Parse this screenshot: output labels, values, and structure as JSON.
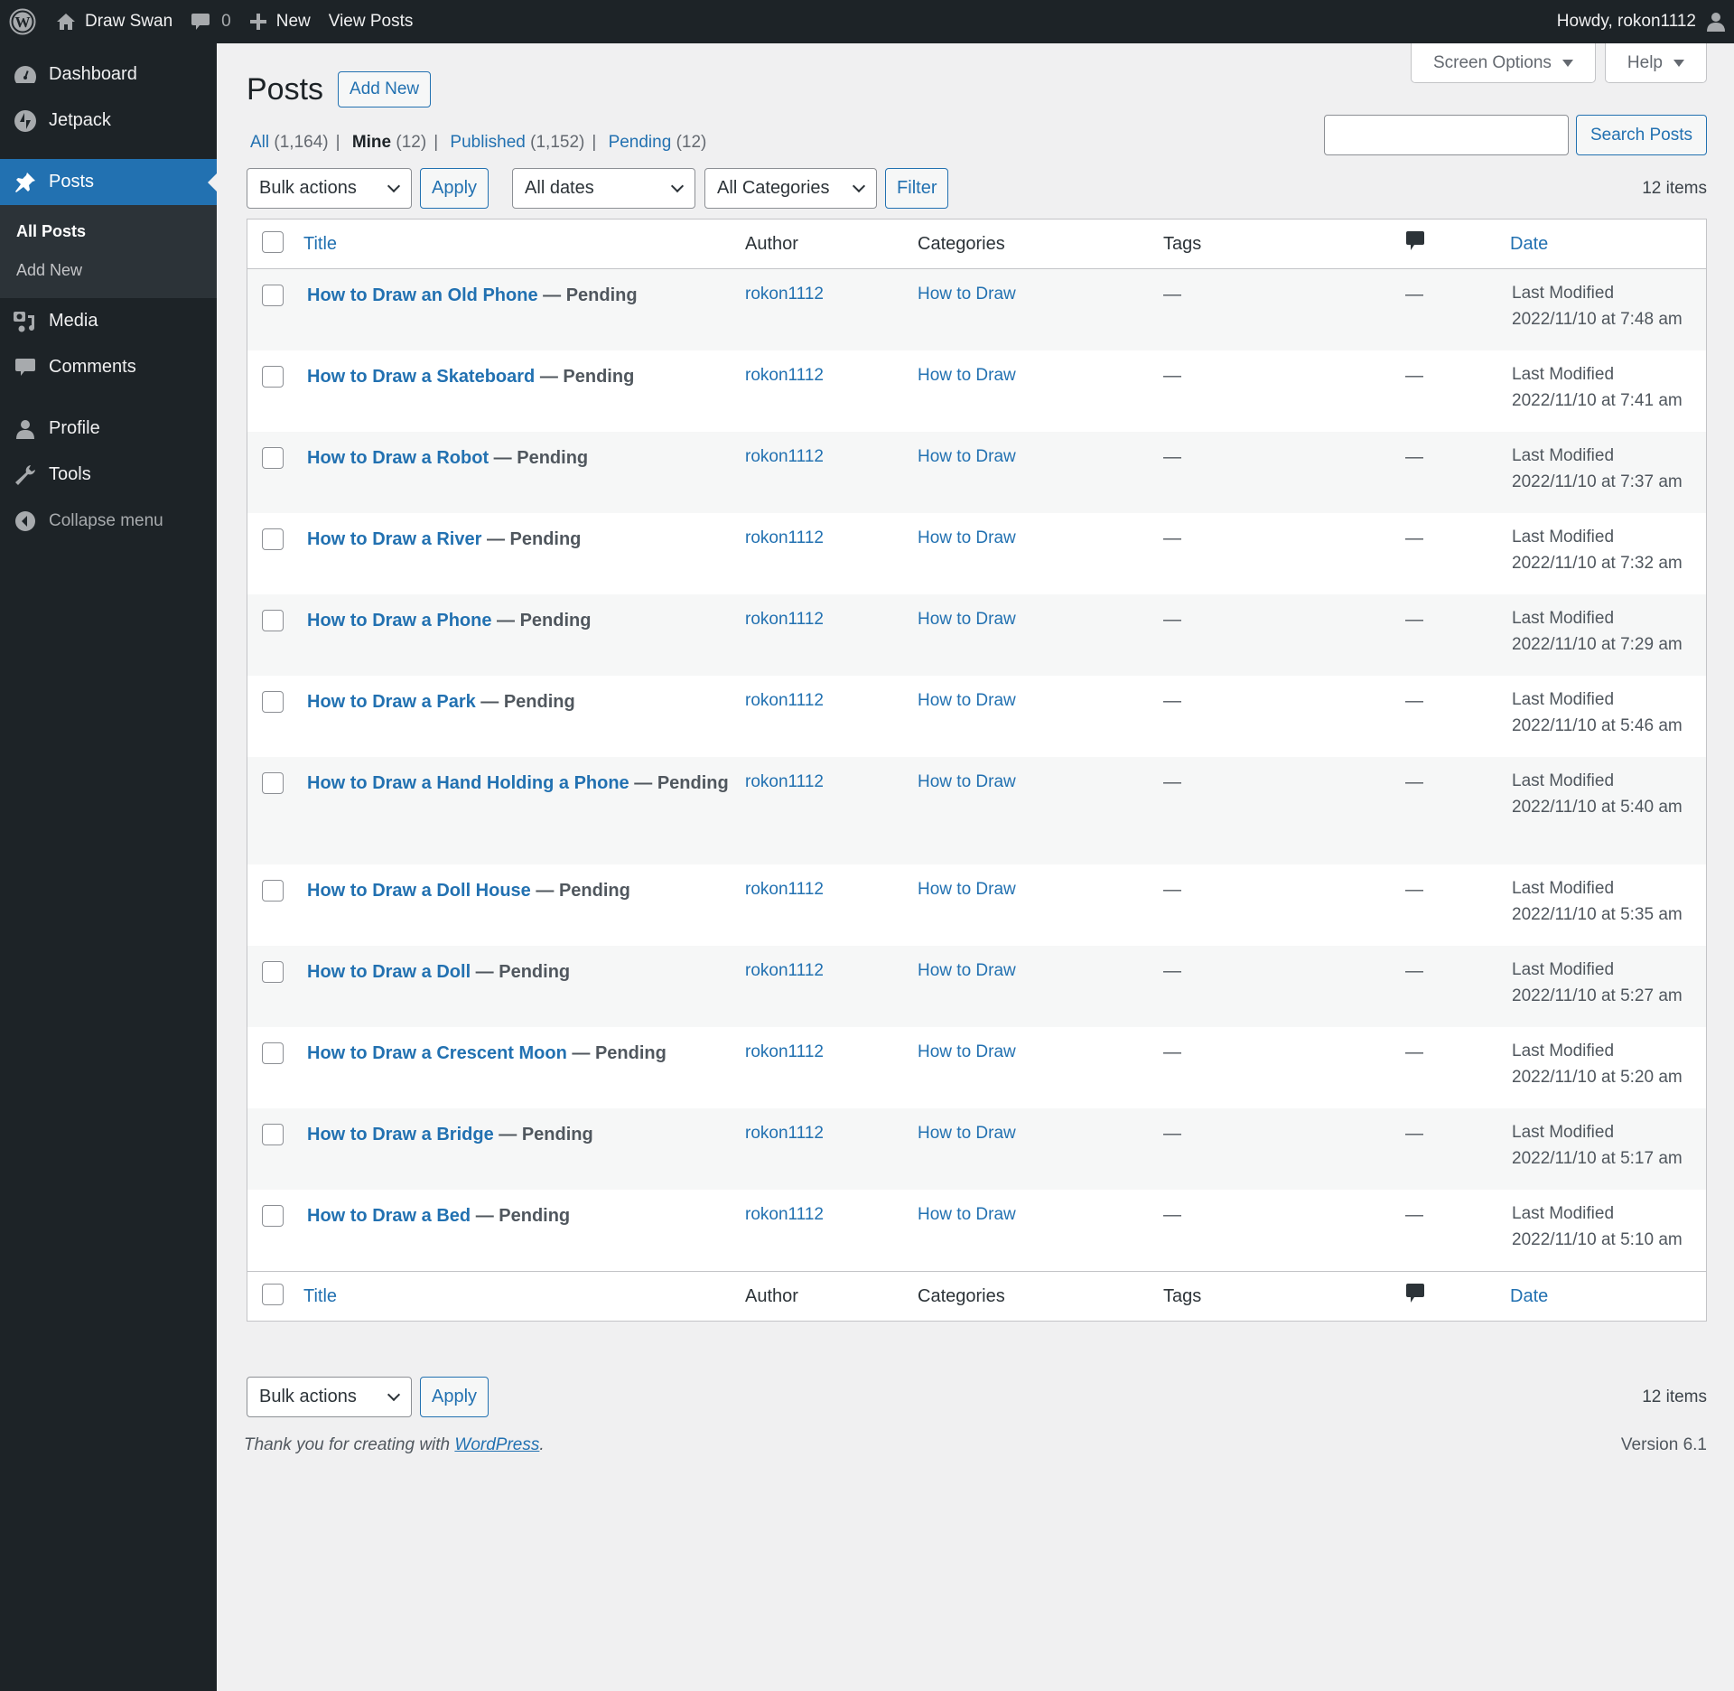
{
  "adminbar": {
    "site_name": "Draw Swan",
    "comments_count": "0",
    "new_label": "New",
    "view_posts_label": "View Posts",
    "greeting": "Howdy, rokon1112"
  },
  "sidebar": {
    "items": [
      {
        "label": "Dashboard",
        "icon": "dashboard-icon"
      },
      {
        "label": "Jetpack",
        "icon": "jetpack-icon"
      },
      {
        "label": "Posts",
        "icon": "pin-icon",
        "current": true
      },
      {
        "label": "Media",
        "icon": "media-icon"
      },
      {
        "label": "Comments",
        "icon": "comment-icon"
      },
      {
        "label": "Profile",
        "icon": "user-icon"
      },
      {
        "label": "Tools",
        "icon": "wrench-icon"
      },
      {
        "label": "Collapse menu",
        "icon": "collapse-icon"
      }
    ],
    "submenu": [
      {
        "label": "All Posts",
        "current": true
      },
      {
        "label": "Add New"
      }
    ]
  },
  "screen_meta": {
    "screen_options_label": "Screen Options",
    "help_label": "Help"
  },
  "header": {
    "title": "Posts",
    "add_new_label": "Add New"
  },
  "views": [
    {
      "label": "All",
      "count": "(1,164)"
    },
    {
      "label": "Mine",
      "count": "(12)",
      "current": true
    },
    {
      "label": "Published",
      "count": "(1,152)"
    },
    {
      "label": "Pending",
      "count": "(12)"
    }
  ],
  "search": {
    "value": "",
    "button_label": "Search Posts"
  },
  "tablenav_top": {
    "bulk_actions": "Bulk actions",
    "apply_label": "Apply",
    "dates_filter": "All dates",
    "categories_filter": "All Categories",
    "filter_label": "Filter",
    "items_count": "12 items"
  },
  "table": {
    "columns": {
      "title": "Title",
      "author": "Author",
      "categories": "Categories",
      "tags": "Tags",
      "comments_icon": "comment-icon",
      "date": "Date"
    },
    "rows": [
      {
        "title": "How to Draw an Old Phone",
        "state": "Pending",
        "author": "rokon1112",
        "category": "How to Draw",
        "tags": "—",
        "comments": "—",
        "date_label": "Last Modified",
        "date": "2022/11/10 at 7:48 am"
      },
      {
        "title": "How to Draw a Skateboard",
        "state": "Pending",
        "author": "rokon1112",
        "category": "How to Draw",
        "tags": "—",
        "comments": "—",
        "date_label": "Last Modified",
        "date": "2022/11/10 at 7:41 am"
      },
      {
        "title": "How to Draw a Robot",
        "state": "Pending",
        "author": "rokon1112",
        "category": "How to Draw",
        "tags": "—",
        "comments": "—",
        "date_label": "Last Modified",
        "date": "2022/11/10 at 7:37 am"
      },
      {
        "title": "How to Draw a River",
        "state": "Pending",
        "author": "rokon1112",
        "category": "How to Draw",
        "tags": "—",
        "comments": "—",
        "date_label": "Last Modified",
        "date": "2022/11/10 at 7:32 am"
      },
      {
        "title": "How to Draw a Phone",
        "state": "Pending",
        "author": "rokon1112",
        "category": "How to Draw",
        "tags": "—",
        "comments": "—",
        "date_label": "Last Modified",
        "date": "2022/11/10 at 7:29 am"
      },
      {
        "title": "How to Draw a Park",
        "state": "Pending",
        "author": "rokon1112",
        "category": "How to Draw",
        "tags": "—",
        "comments": "—",
        "date_label": "Last Modified",
        "date": "2022/11/10 at 5:46 am"
      },
      {
        "title": "How to Draw a Hand Holding a Phone",
        "state": "Pending",
        "author": "rokon1112",
        "category": "How to Draw",
        "tags": "—",
        "comments": "—",
        "date_label": "Last Modified",
        "date": "2022/11/10 at 5:40 am"
      },
      {
        "title": "How to Draw a Doll House",
        "state": "Pending",
        "author": "rokon1112",
        "category": "How to Draw",
        "tags": "—",
        "comments": "—",
        "date_label": "Last Modified",
        "date": "2022/11/10 at 5:35 am"
      },
      {
        "title": "How to Draw a Doll",
        "state": "Pending",
        "author": "rokon1112",
        "category": "How to Draw",
        "tags": "—",
        "comments": "—",
        "date_label": "Last Modified",
        "date": "2022/11/10 at 5:27 am"
      },
      {
        "title": "How to Draw a Crescent Moon",
        "state": "Pending",
        "author": "rokon1112",
        "category": "How to Draw",
        "tags": "—",
        "comments": "—",
        "date_label": "Last Modified",
        "date": "2022/11/10 at 5:20 am"
      },
      {
        "title": "How to Draw a Bridge",
        "state": "Pending",
        "author": "rokon1112",
        "category": "How to Draw",
        "tags": "—",
        "comments": "—",
        "date_label": "Last Modified",
        "date": "2022/11/10 at 5:17 am"
      },
      {
        "title": "How to Draw a Bed",
        "state": "Pending",
        "author": "rokon1112",
        "category": "How to Draw",
        "tags": "—",
        "comments": "—",
        "date_label": "Last Modified",
        "date": "2022/11/10 at 5:10 am"
      }
    ]
  },
  "tablenav_bottom": {
    "bulk_actions": "Bulk actions",
    "apply_label": "Apply",
    "items_count": "12 items"
  },
  "footer": {
    "thanks_text": "Thank you for creating with ",
    "wordpress_link": "WordPress",
    "period": ".",
    "version": "Version 6.1"
  },
  "colors": {
    "accent": "#2271b1",
    "adminbar_bg": "#1d2327",
    "submenu_bg": "#2c3338",
    "page_bg": "#f0f0f1",
    "row_alt_bg": "#f6f7f7"
  }
}
